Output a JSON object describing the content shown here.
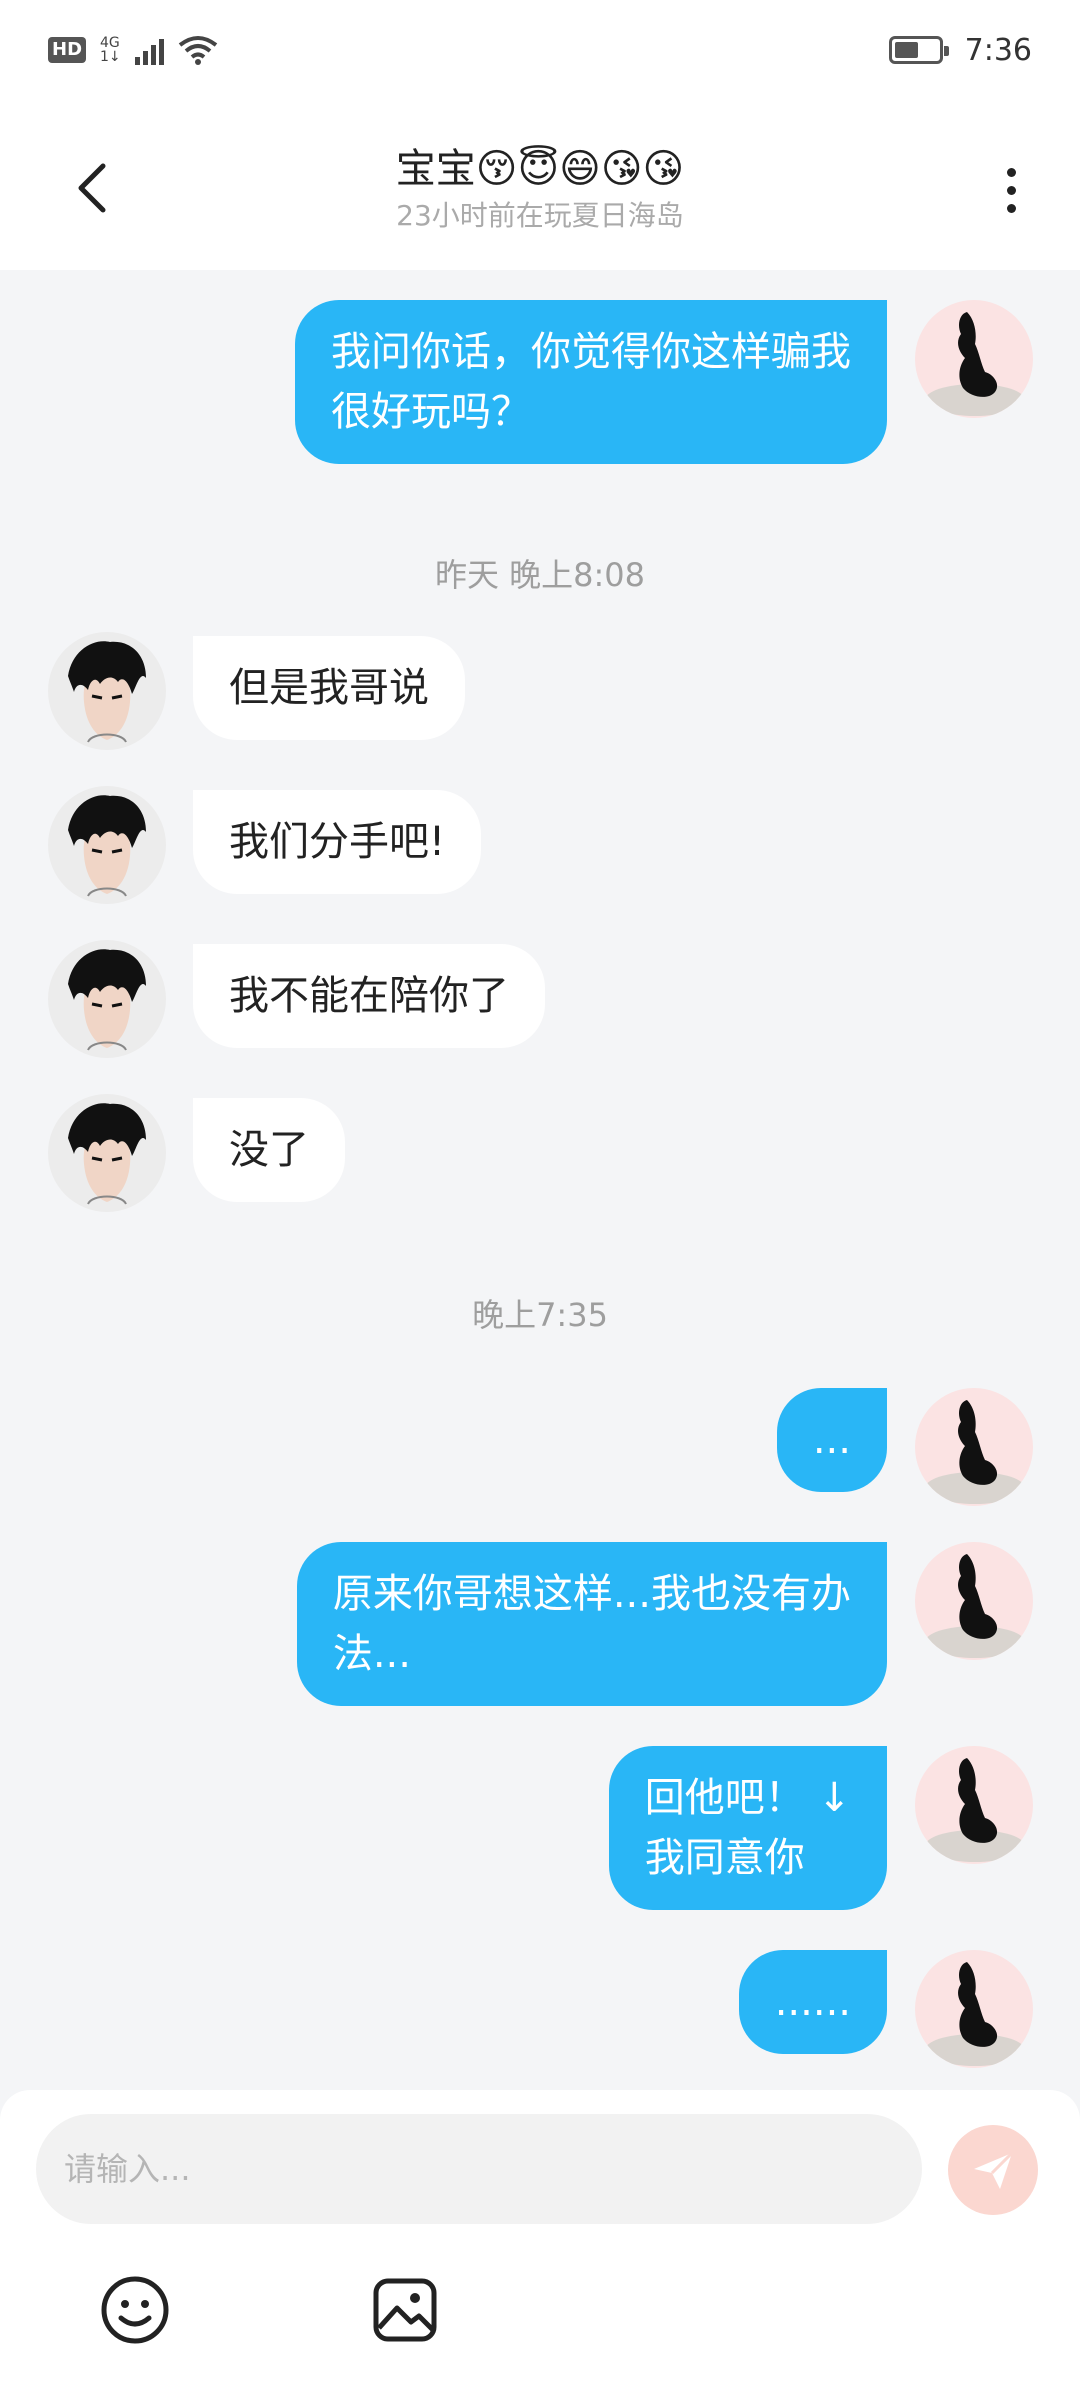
{
  "status_bar": {
    "hd": "HD",
    "net_top": "4G",
    "net_bottom": "1↓",
    "time": "7:36",
    "battery_level": 0.55
  },
  "header": {
    "title": "宝宝😚😇😄😘😘",
    "subtitle": "23小时前在玩夏日海岛"
  },
  "messages": [
    {
      "side": "self",
      "text_lines": [
        "我问你话，你觉得你这样骗我",
        "很好玩吗？"
      ]
    },
    {
      "type": "timestamp",
      "text": "昨天 晚上8:08"
    },
    {
      "side": "other",
      "text": "但是我哥说"
    },
    {
      "side": "other",
      "text": "我们分手吧!"
    },
    {
      "side": "other",
      "text": "我不能在陪你了"
    },
    {
      "side": "other",
      "text": "没了"
    },
    {
      "type": "timestamp",
      "text": "晚上7:35"
    },
    {
      "side": "self",
      "text": "..."
    },
    {
      "side": "self",
      "text_lines": [
        "原来你哥想这样...我也没有办",
        "法..."
      ]
    },
    {
      "side": "self",
      "text_lines": [
        "回他吧！ ↓",
        "我同意你"
      ]
    },
    {
      "side": "self",
      "text": "......"
    }
  ],
  "input": {
    "placeholder": "请输入..."
  },
  "colors": {
    "self_bubble": "#29b6f6",
    "other_bubble": "#ffffff",
    "send_button": "#fbd7d0"
  },
  "icons": [
    "back-arrow-icon",
    "more-vertical-icon",
    "send-icon",
    "emoji-icon",
    "image-icon"
  ]
}
